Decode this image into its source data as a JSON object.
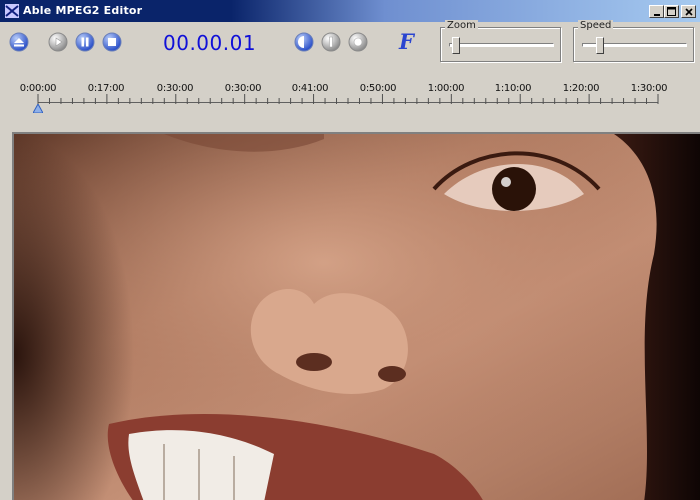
{
  "window": {
    "title": "Able MPEG2 Editor"
  },
  "toolbar": {
    "buttons": [
      {
        "name": "eject-icon"
      },
      {
        "name": "play-icon"
      },
      {
        "name": "pause-icon"
      },
      {
        "name": "stop-icon"
      }
    ],
    "timecode": "00.00.01",
    "mark_buttons": [
      {
        "name": "mark-in-icon"
      },
      {
        "name": "mark-middle-icon"
      },
      {
        "name": "mark-out-icon"
      }
    ],
    "f_label": "F",
    "zoom_label": "Zoom",
    "speed_label": "Speed"
  },
  "timeline": {
    "labels": [
      "0:00:00",
      "0:17:00",
      "0:30:00",
      "0:30:00",
      "0:41:00",
      "0:50:00",
      "1:00:00",
      "1:10:00",
      "1:20:00",
      "1:30:00"
    ]
  },
  "colors": {
    "titlebar_start": "#0a246a",
    "titlebar_end": "#a6caf0",
    "timecode": "#1010d8",
    "button_blue": "#4a70d8"
  }
}
